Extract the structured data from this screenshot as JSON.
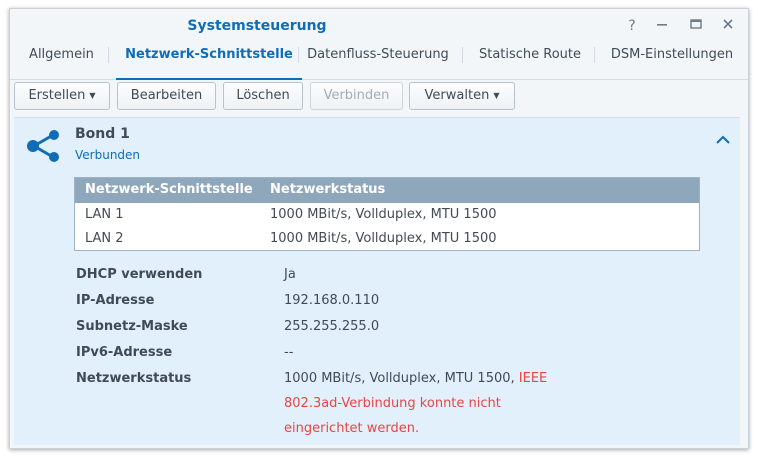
{
  "window": {
    "title": "Systemsteuerung",
    "help_label": "?",
    "minimize_label": "—",
    "maximize_label": "□",
    "close_label": "✕"
  },
  "tabs": [
    {
      "label": "Allgemein",
      "active": false
    },
    {
      "label": "Netzwerk-Schnittstelle",
      "active": true
    },
    {
      "label": "Datenfluss-Steuerung",
      "active": false
    },
    {
      "label": "Statische Route",
      "active": false
    },
    {
      "label": "DSM-Einstellungen",
      "active": false
    }
  ],
  "toolbar": {
    "create_label": "Erstellen",
    "edit_label": "Bearbeiten",
    "delete_label": "Löschen",
    "connect_label": "Verbinden",
    "manage_label": "Verwalten"
  },
  "bond": {
    "name": "Bond 1",
    "status": "Verbunden",
    "table": {
      "headers": [
        "Netzwerk-Schnittstelle",
        "Netzwerkstatus"
      ],
      "rows": [
        [
          "LAN 1",
          "1000 MBit/s, Vollduplex, MTU 1500"
        ],
        [
          "LAN 2",
          "1000 MBit/s, Vollduplex, MTU 1500"
        ]
      ]
    },
    "details": {
      "dhcp_label": "DHCP verwenden",
      "dhcp_value": "Ja",
      "ip_label": "IP-Adresse",
      "ip_value": "192.168.0.110",
      "subnet_label": "Subnetz-Maske",
      "subnet_value": "255.255.255.0",
      "ipv6_label": "IPv6-Adresse",
      "ipv6_value": "--",
      "netstatus_label": "Netzwerkstatus",
      "netstatus_value": "1000 MBit/s, Vollduplex, MTU 1500, ",
      "netstatus_error_line1": "IEEE",
      "netstatus_error_line2": "802.3ad-Verbindung konnte nicht",
      "netstatus_error_line3": "eingerichtet werden."
    }
  },
  "colors": {
    "accent": "#0f6db5",
    "panel_bg": "#e1f0fb",
    "table_header": "#8fa7bb",
    "error": "#e84545"
  }
}
